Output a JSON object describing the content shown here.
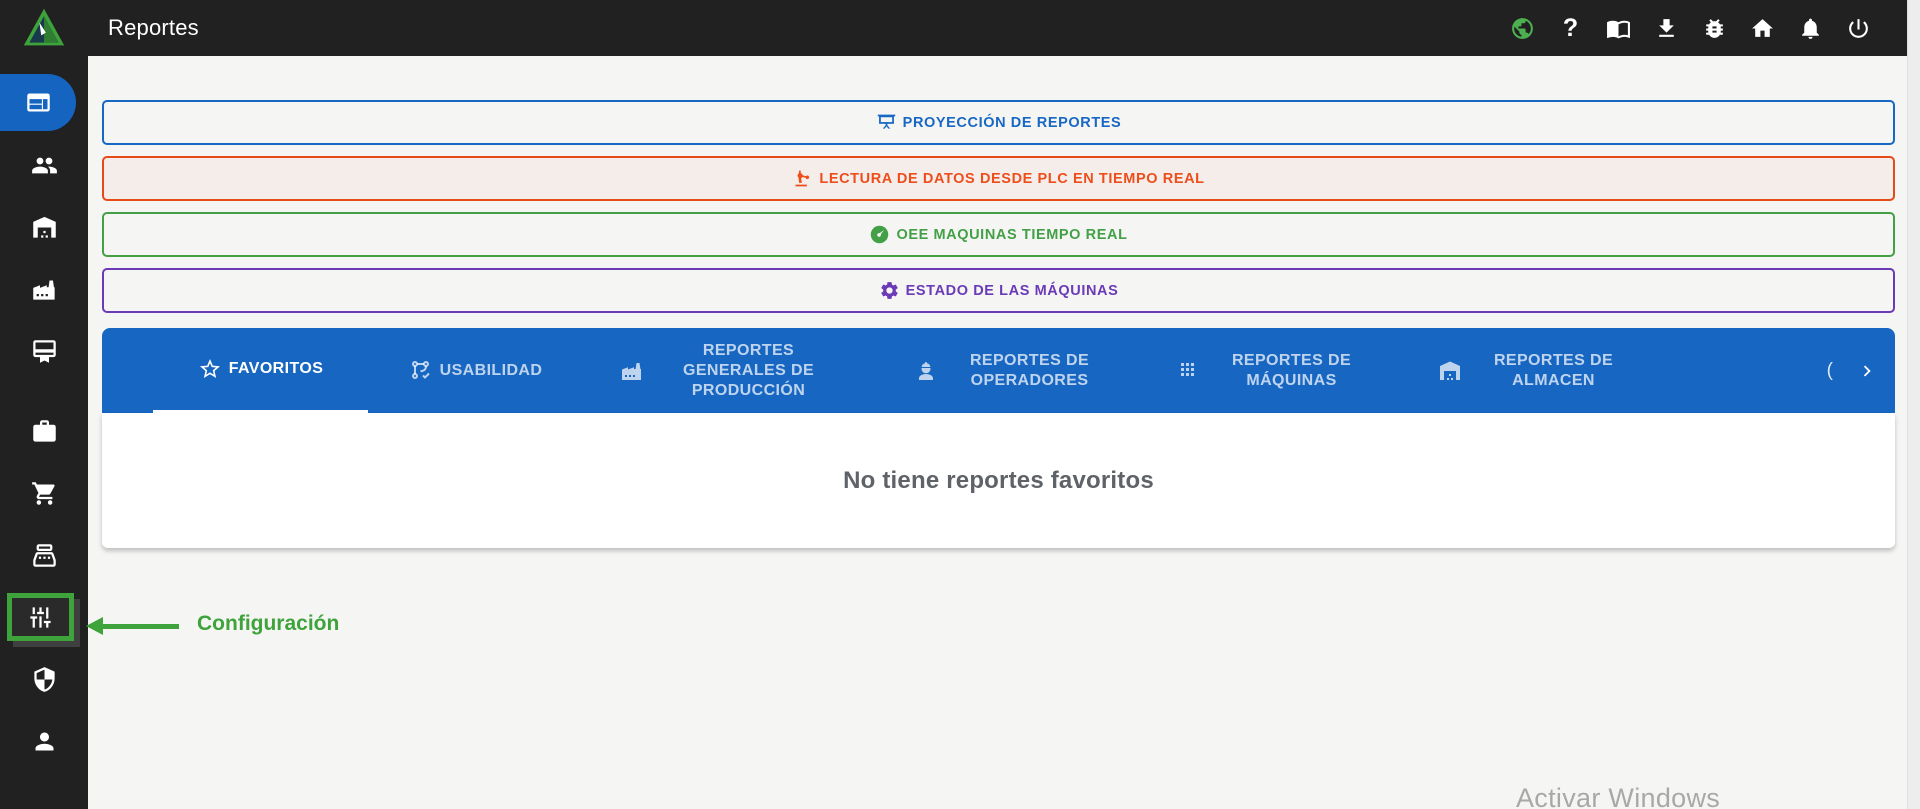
{
  "topbar": {
    "title": "Reportes",
    "help_glyph": "?",
    "icons": [
      "globe-icon",
      "help-icon",
      "manual-book-icon",
      "download-icon",
      "bug-report-icon",
      "home-icon",
      "notifications-icon",
      "power-icon"
    ]
  },
  "sidebar": {
    "items": [
      {
        "icon": "reports-news-icon",
        "active": true
      },
      {
        "icon": "people-icon"
      },
      {
        "icon": "warehouse-icon"
      },
      {
        "icon": "factory-icon"
      },
      {
        "icon": "certificate-icon"
      },
      {
        "icon": "briefcase-icon"
      },
      {
        "icon": "shopping-cart-icon"
      },
      {
        "icon": "cash-register-icon"
      },
      {
        "icon": "tune-settings-icon",
        "highlighted": true
      },
      {
        "icon": "shield-icon"
      },
      {
        "icon": "person-icon"
      }
    ]
  },
  "actions": [
    {
      "label": "PROYECCIÓN DE REPORTES",
      "icon": "projector-screen-icon",
      "color": "#1767C4"
    },
    {
      "label": "LECTURA DE DATOS DESDE PLC EN TIEMPO REAL",
      "icon": "robot-arm-icon",
      "color": "#E64A19"
    },
    {
      "label": "OEE MAQUINAS TIEMPO REAL",
      "icon": "gauge-icon",
      "color": "#43A047"
    },
    {
      "label": "ESTADO DE LAS MÁQUINAS",
      "icon": "gear-icon",
      "color": "#6A3AB7"
    }
  ],
  "tabs": {
    "items": [
      {
        "label": "FAVORITOS",
        "icon": "star-icon",
        "active": true
      },
      {
        "label": "USABILIDAD",
        "icon": "usability-branch-icon"
      },
      {
        "label": "REPORTES GENERALES DE PRODUCCIÓN",
        "icon": "factory-icon"
      },
      {
        "label": "REPORTES DE OPERADORES",
        "icon": "operator-icon"
      },
      {
        "label": "REPORTES DE MÁQUINAS",
        "icon": "machines-grid-icon"
      },
      {
        "label": "REPORTES DE ALMACEN",
        "icon": "warehouse-icon"
      }
    ],
    "clipped_label": "(",
    "scroll_icon": "chevron-right-icon"
  },
  "favorites": {
    "empty_message": "No tiene reportes favoritos"
  },
  "annotation": {
    "label": "Configuración",
    "color": "#3FA33C"
  },
  "watermark": {
    "line1": "Activar Windows"
  },
  "colors": {
    "topbar_bg": "#212121",
    "sidebar_bg": "#212121",
    "page_bg": "#F5F5F4",
    "primary_blue": "#1565C0",
    "tab_bar_blue": "#1766C2",
    "orange": "#E64A19",
    "green": "#43A047",
    "purple": "#6A3AB7",
    "annotation_green": "#3FA33C",
    "empty_text": "#5F6368",
    "globe_green": "#4CAF50"
  }
}
